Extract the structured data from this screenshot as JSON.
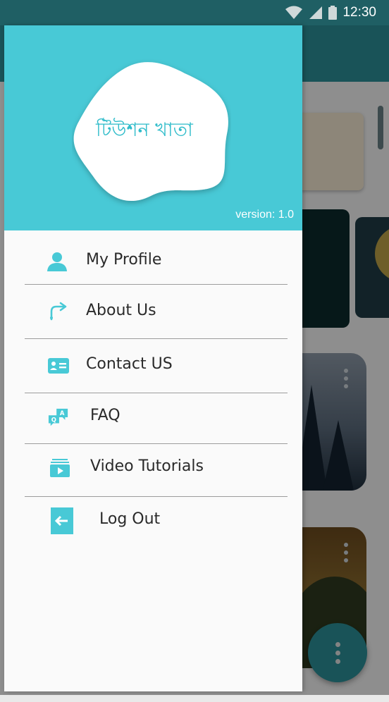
{
  "status_bar": {
    "time": "12:30"
  },
  "drawer": {
    "app_title": "টিউশন খাতা",
    "version": "version: 1.0",
    "menu": [
      {
        "label": "My Profile",
        "icon": "person-icon"
      },
      {
        "label": "About Us",
        "icon": "share-arrow-icon"
      },
      {
        "label": "Contact US",
        "icon": "contact-card-icon"
      },
      {
        "label": "FAQ",
        "icon": "qa-chat-icon"
      },
      {
        "label": "Video Tutorials",
        "icon": "video-library-icon"
      },
      {
        "label": "Log Out",
        "icon": "logout-icon"
      }
    ]
  },
  "colors": {
    "accent": "#48c9d6",
    "app_bar": "#2b8f98",
    "status_bar": "#1f5f64",
    "drawer_bg": "#fafafa",
    "title_text": "#2fbcca"
  }
}
